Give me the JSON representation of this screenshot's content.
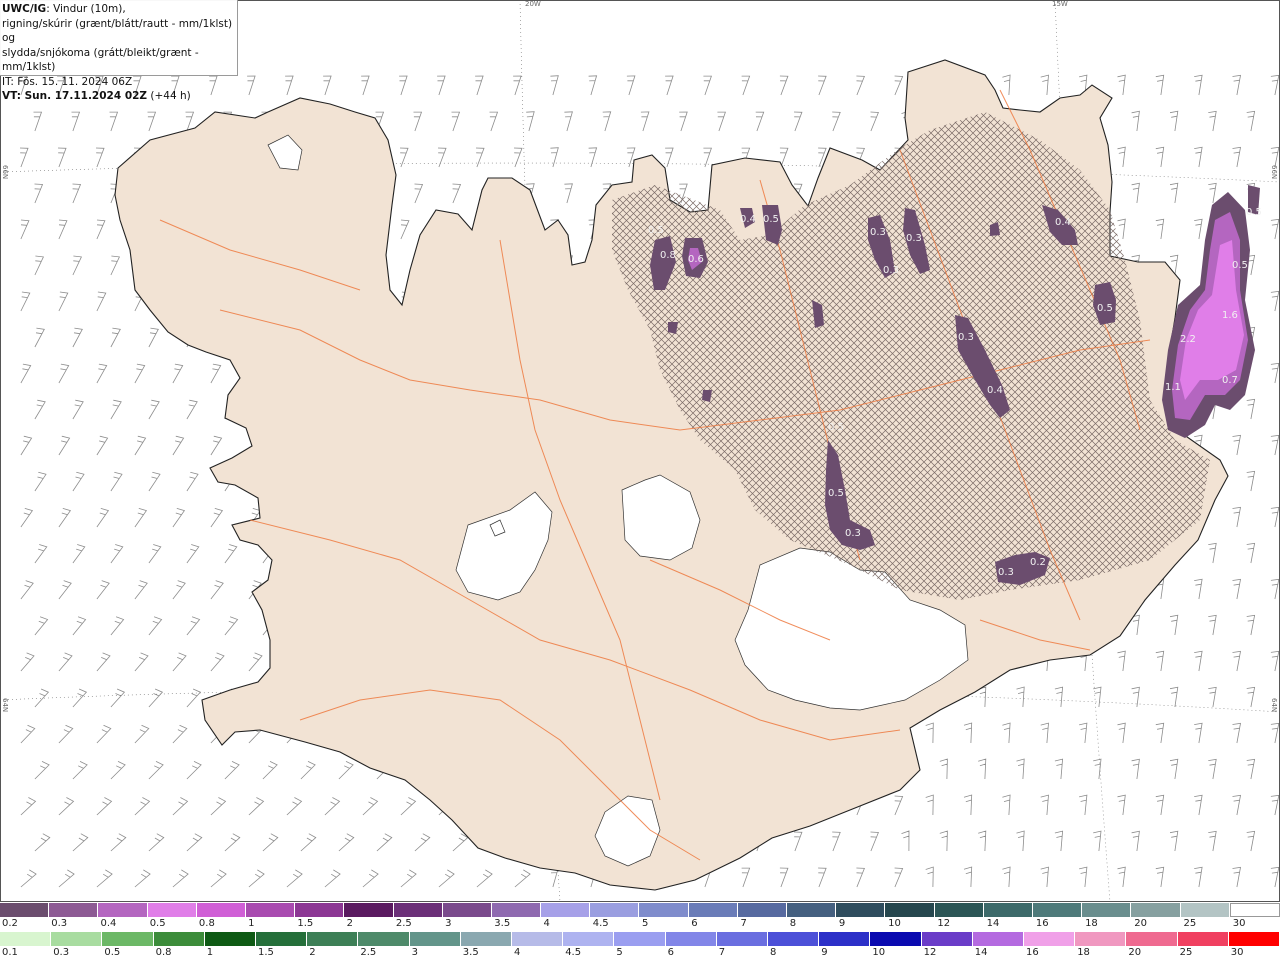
{
  "info": {
    "title": "UWC/IG",
    "description_line1": ": Vindur (10m),",
    "description_line2": "rigning/skúrir (grænt/blátt/rautt - mm/1klst) og",
    "description_line3": "slydda/snjókoma (grátt/bleikt/grænt - mm/1klst)",
    "init_time": "IT: Fös. 15. 11. 2024 06Z",
    "valid_label": "VT:",
    "valid_time": " Sun. 17.11.2024 02Z",
    "lead_time": " (+44 h)"
  },
  "grid_labels": {
    "top_left": "20W",
    "top_right": "15W",
    "left_upper": "66N",
    "left_lower": "64N",
    "right_upper": "66N",
    "right_lower": "64N"
  },
  "precip_values": [
    {
      "text": "0.5"
    },
    {
      "text": "0.8"
    },
    {
      "text": "0.6"
    },
    {
      "text": "0.4"
    },
    {
      "text": "0.5"
    },
    {
      "text": "0.3"
    },
    {
      "text": "0.3"
    },
    {
      "text": "0.3"
    },
    {
      "text": "0.4"
    },
    {
      "text": "0.5"
    },
    {
      "text": "0.3"
    },
    {
      "text": "0.4"
    },
    {
      "text": "0.5"
    },
    {
      "text": "0.3"
    },
    {
      "text": "0.3"
    },
    {
      "text": "0.2"
    },
    {
      "text": "0.5"
    },
    {
      "text": "1.6"
    },
    {
      "text": "2.2"
    },
    {
      "text": "1.1"
    },
    {
      "text": "0.7"
    },
    {
      "text": "0.5"
    },
    {
      "text": "0.5"
    }
  ],
  "legend_snow": {
    "labels": [
      "0.2",
      "0.3",
      "0.4",
      "0.5",
      "0.8",
      "1",
      "1.5",
      "2",
      "2.5",
      "3",
      "3.5",
      "4",
      "4.5",
      "5",
      "6",
      "7",
      "8",
      "9",
      "10",
      "12",
      "14",
      "16",
      "18",
      "20",
      "25",
      "30"
    ],
    "colors": [
      "#6b4d6e",
      "#8d5a94",
      "#b466c0",
      "#e07ee8",
      "#d05fd6",
      "#a94bb0",
      "#8c3794",
      "#5a1a60",
      "#6b2f78",
      "#7a4a8c",
      "#8f6ab0",
      "#a6a0e8",
      "#9a9ee0",
      "#7f8ccc",
      "#6a7cb8",
      "#576aa0",
      "#456080",
      "#2f4d5e",
      "#26474e",
      "#2c5656",
      "#3d6a6a",
      "#4e7a7a",
      "#6a8e8e",
      "#86a0a0",
      "#b3c4c4",
      "#ffffff"
    ]
  },
  "legend_rain": {
    "labels": [
      "0.1",
      "0.3",
      "0.5",
      "0.8",
      "1",
      "1.5",
      "2",
      "2.5",
      "3",
      "3.5",
      "4",
      "4.5",
      "5",
      "6",
      "7",
      "8",
      "9",
      "10",
      "12",
      "14",
      "16",
      "18",
      "20",
      "25",
      "30"
    ],
    "colors": [
      "#d8f5cf",
      "#a8dca0",
      "#6cb866",
      "#3c8c3a",
      "#0e5a14",
      "#256f3a",
      "#3d7f56",
      "#4e8a6a",
      "#63958a",
      "#8aa8b0",
      "#b6bbe8",
      "#aeb3f0",
      "#9a9ef0",
      "#8286e8",
      "#6a6ee0",
      "#4c50d8",
      "#2c30c8",
      "#0a0ab0",
      "#6a3cc8",
      "#b46ae0",
      "#f0a0e8",
      "#f098c0",
      "#ef6a90",
      "#f04060",
      "#ff0000"
    ]
  }
}
